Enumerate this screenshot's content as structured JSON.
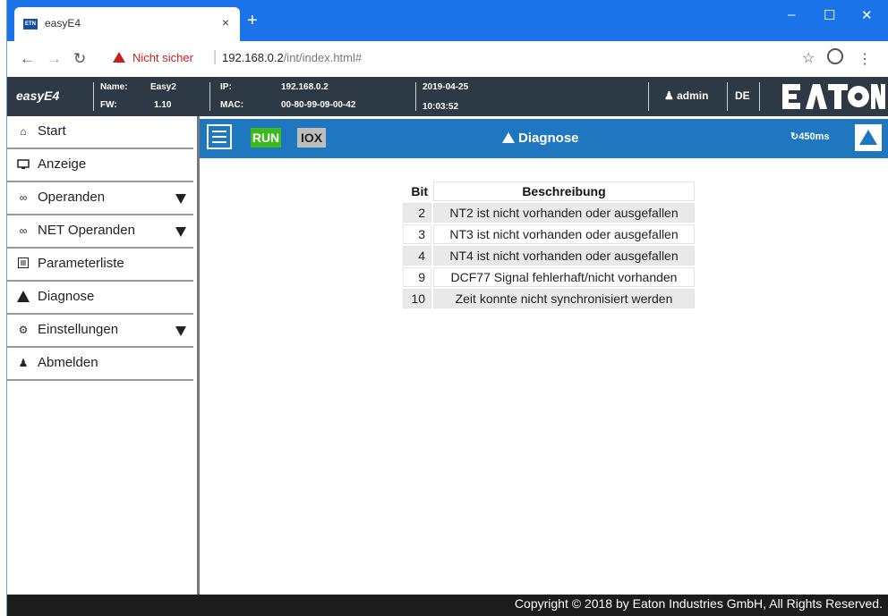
{
  "browser": {
    "tab_title": "easyE4",
    "tab_favicon_text": "ETN",
    "tab_close": "×",
    "new_tab": "+",
    "security_label": "Nicht sicher",
    "url_host": "192.168.0.2",
    "url_path": "/int/index.html#"
  },
  "header": {
    "brand": "easyE4",
    "name_label": "Name:",
    "name_value": "Easy2",
    "fw_label": "FW:",
    "fw_value": "1.10",
    "ip_label": "IP:",
    "ip_value": "192.168.0.2",
    "mac_label": "MAC:",
    "mac_value": "00-80-99-09-00-42",
    "date": "2019-04-25",
    "time": "10:03:52",
    "user": "admin",
    "language": "DE",
    "logo_text": "EATON"
  },
  "sidebar": {
    "items": [
      {
        "label": "Start",
        "icon": "home-icon"
      },
      {
        "label": "Anzeige",
        "icon": "monitor-icon"
      },
      {
        "label": "Operanden",
        "icon": "glasses-icon"
      },
      {
        "label": "NET Operanden",
        "icon": "glasses-icon"
      },
      {
        "label": "Parameterliste",
        "icon": "list-icon"
      },
      {
        "label": "Diagnose",
        "icon": "warning-icon"
      },
      {
        "label": "Einstellungen",
        "icon": "gear-icon"
      },
      {
        "label": "Abmelden",
        "icon": "user-icon"
      }
    ]
  },
  "toolbar": {
    "run": "RUN",
    "iox": "IOX",
    "title": "Diagnose",
    "refresh": "450ms"
  },
  "diagnose": {
    "headers": [
      "Bit",
      "Beschreibung"
    ],
    "rows": [
      {
        "bit": "2",
        "desc": "NT2 ist nicht vorhanden oder ausgefallen"
      },
      {
        "bit": "3",
        "desc": "NT3 ist nicht vorhanden oder ausgefallen"
      },
      {
        "bit": "4",
        "desc": "NT4 ist nicht vorhanden oder ausgefallen"
      },
      {
        "bit": "9",
        "desc": "DCF77 Signal fehlerhaft/nicht vorhanden"
      },
      {
        "bit": "10",
        "desc": "Zeit konnte nicht synchronisiert werden"
      }
    ]
  },
  "footer": {
    "copyright": "Copyright © 2018 by Eaton Industries GmbH, All Rights Reserved."
  },
  "colors": {
    "browser_blue": "#1a73e8",
    "header_dark": "#2d3a45",
    "toolbar_blue": "#1f78bf",
    "run_green": "#3cba1c",
    "warning_red": "#c5221f"
  }
}
